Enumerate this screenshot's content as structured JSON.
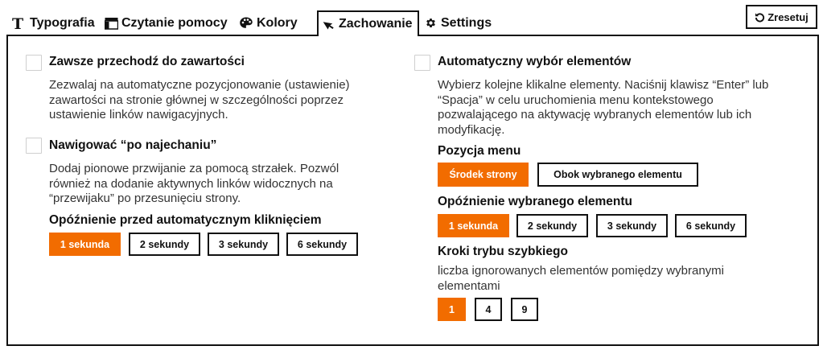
{
  "accent_color": "#f26c00",
  "tabs": [
    {
      "label": "Typografia",
      "icon": "typography-icon"
    },
    {
      "label": "Czytanie pomocy",
      "icon": "reading-aid-icon"
    },
    {
      "label": "Kolory",
      "icon": "palette-icon"
    },
    {
      "label": "Zachowanie",
      "icon": "cursor-behavior-icon",
      "active": true
    },
    {
      "label": "Settings",
      "icon": "gear-icon"
    }
  ],
  "reset_label": "Zresetuj",
  "left": {
    "skip_content": {
      "title": "Zawsze przechodź do zawartości",
      "desc": "Zezwalaj na automatyczne pozycjonowanie (ustawienie) zawartości na stronie głównej w szczególności poprzez ustawienie linków nawigacyjnych.",
      "checked": false
    },
    "hover_nav": {
      "title": "Nawigować “po najechaniu”",
      "desc": "Dodaj pionowe przwijanie za pomocą strzałek. Pozwól również na dodanie aktywnych linków widocznych na “przewijaku” po przesunięciu strony.",
      "checked": false
    },
    "click_delay": {
      "label": "Opóźnienie przed automatycznym kliknięciem",
      "options": [
        "1 sekunda",
        "2 sekundy",
        "3 sekundy",
        "6 sekundy"
      ],
      "selected": "1 sekunda"
    }
  },
  "right": {
    "auto_select": {
      "title": "Automatyczny wybór elementów",
      "desc": "Wybierz kolejne klikalne elementy. Naciśnij klawisz “Enter” lub “Spacja” w celu uruchomienia menu kontekstowego pozwalającego na aktywację wybranych elementów lub ich modyfikację.",
      "checked": false
    },
    "menu_position": {
      "label": "Pozycja menu",
      "options": [
        "Środek strony",
        "Obok wybranego elementu"
      ],
      "selected": "Środek strony"
    },
    "element_delay": {
      "label": "Opóźnienie wybranego elementu",
      "options": [
        "1 sekunda",
        "2 sekundy",
        "3 sekundy",
        "6 sekundy"
      ],
      "selected": "1 sekunda"
    },
    "fast_steps": {
      "label": "Kroki trybu szybkiego",
      "desc": "liczba ignorowanych elementów pomiędzy wybranymi elementami",
      "options": [
        "1",
        "4",
        "9"
      ],
      "selected": "1"
    }
  }
}
